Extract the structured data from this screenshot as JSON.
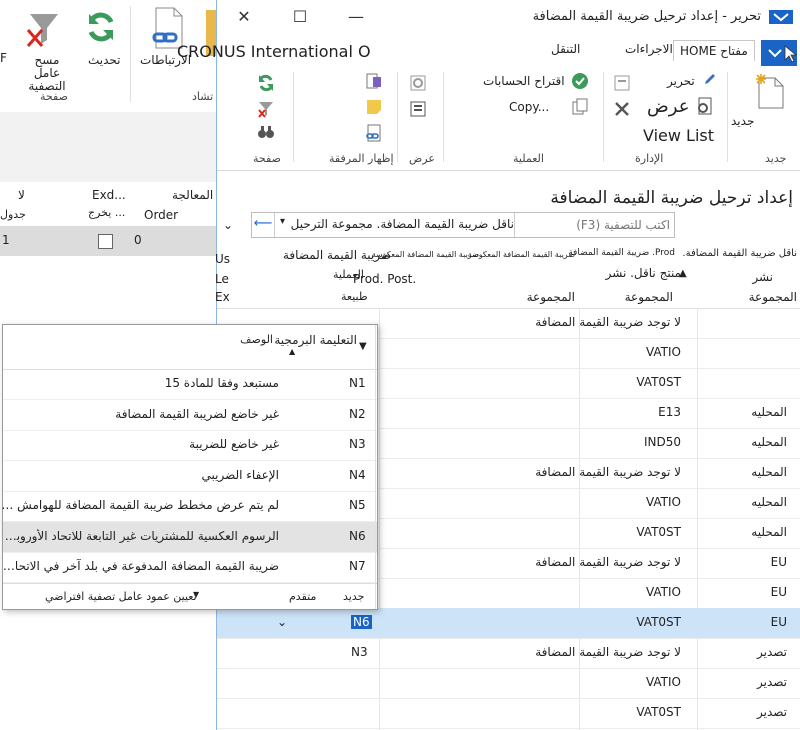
{
  "background_window": {
    "ribbon": {
      "clear_filter_label": "مسح عامل التصفية",
      "refresh_label": "تحديث",
      "links_label": "الارتباطات",
      "page_group": "صفحة",
      "partial_label": "تشاد",
      "f_label": "F"
    },
    "grid": {
      "col_processing": "المعالجة",
      "col_processing2": "لا",
      "col_exclude": "Exd...",
      "col_exclude2": "يخرج ...",
      "col_schedule": "جدول",
      "col_order": "Order",
      "row_value": "0",
      "row_value2": "1"
    }
  },
  "main_window": {
    "title": "تحرير - إعداد ترحيل ضريبة القيمة المضافة",
    "company": "CRONUS International O",
    "tabs": {
      "home": "مفتاح HOME",
      "actions": "الاجراءات",
      "navigate": "التنقل"
    },
    "ribbon": {
      "new": "جديد",
      "edit": "تحرير",
      "view": "عرض",
      "view_list": "View List",
      "suggest_accounts": "اقتراح الحسابات",
      "copy": "Copy...",
      "show_attached": "إظهار المرفقة",
      "page": "صفحة",
      "groups": {
        "new": "جديد",
        "manage": "الإدارة",
        "process": "العملية",
        "view": "عرض",
        "show_attached": "إظهار المرفقة",
        "page": "صفحة"
      }
    },
    "page_title": "إعداد ترحيل ضريبة القيمة المضافة",
    "filter": {
      "search_placeholder": "اكتب للتصفية (F3)",
      "field": "ناقل ضريبة القيمة المضافة. مجموعة الترحيل"
    },
    "columns": {
      "bus_posting": "ناقل ضريبة القيمة المضافة.",
      "bus_posting_line2": "نشر",
      "group": "المجموعة",
      "prod_posting": "Prod. ضريبة القيمة المضافة",
      "prod_posting_line2": "منتج ناقل. نشر",
      "group2": "المجموعة",
      "vat_reverse": "ضريبة القيمة المضافة المعكوسة",
      "group3": "المجموعة",
      "vat_reverse_calc": "ضريبة القيمة المضافة المعكوسة",
      "prod_post": "Prod. Post.",
      "vat_group": "ضريبة القيمة المضافة",
      "vat_group_line2": "العملية",
      "nature": "طبيعة",
      "us_label": "Us",
      "le_label": "Le",
      "ex_label": "Ex"
    },
    "rows": [
      {
        "bus": "",
        "prod": "لا توجد ضريبة القيمة المضافة",
        "code": ""
      },
      {
        "bus": "",
        "prod": "VATIO",
        "code": ""
      },
      {
        "bus": "",
        "prod": "VAT0ST",
        "code": ""
      },
      {
        "bus": "المحليه",
        "prod": "E13",
        "code": ""
      },
      {
        "bus": "المحليه",
        "prod": "IND50",
        "code": ""
      },
      {
        "bus": "المحليه",
        "prod": "لا توجد ضريبة القيمة المضافة",
        "code": ""
      },
      {
        "bus": "المحليه",
        "prod": "VATIO",
        "code": ""
      },
      {
        "bus": "المحليه",
        "prod": "VAT0ST",
        "code": ""
      },
      {
        "bus": "EU",
        "prod": "لا توجد ضريبة القيمة المضافة",
        "code": ""
      },
      {
        "bus": "EU",
        "prod": "VATIO",
        "code": ""
      },
      {
        "bus": "EU",
        "prod": "VAT0ST",
        "code": "N6"
      },
      {
        "bus": "تصدير",
        "prod": "لا توجد ضريبة القيمة المضافة",
        "code": "N3"
      },
      {
        "bus": "تصدير",
        "prod": "VATIO",
        "code": ""
      },
      {
        "bus": "تصدير",
        "prod": "VAT0ST",
        "code": ""
      }
    ]
  },
  "popup": {
    "col_code": "التعليمة البرمجية",
    "col_desc": "الوصف",
    "items": [
      {
        "code": "N1",
        "desc": "مستبعد وفقا للمادة 15"
      },
      {
        "code": "N2",
        "desc": "غير خاضع لضريبة القيمة المضافة"
      },
      {
        "code": "N3",
        "desc": "غير خاضع للضريبة"
      },
      {
        "code": "N4",
        "desc": "الإعفاء الضريبي"
      },
      {
        "code": "N5",
        "desc": "لم يتم عرض مخطط ضريبة القيمة المضافة للهوامش في inv..."
      },
      {
        "code": "N6",
        "desc": "الرسوم العكسية للمشتريات غير التابعة للاتحاد الأوروبي من s..."
      },
      {
        "code": "N7",
        "desc": "ضريبة القيمة المضافة المدفوعة في بلد آخر في الاتحاد الأوروبي"
      }
    ],
    "footer": {
      "new": "جديد",
      "advanced": "متقدم",
      "default_filter": "تعيين عمود عامل تصفية افتراضي"
    }
  },
  "colors": {
    "accent": "#1a64c8",
    "selection": "#cde3f7",
    "highlight": "#e3e3e3"
  }
}
